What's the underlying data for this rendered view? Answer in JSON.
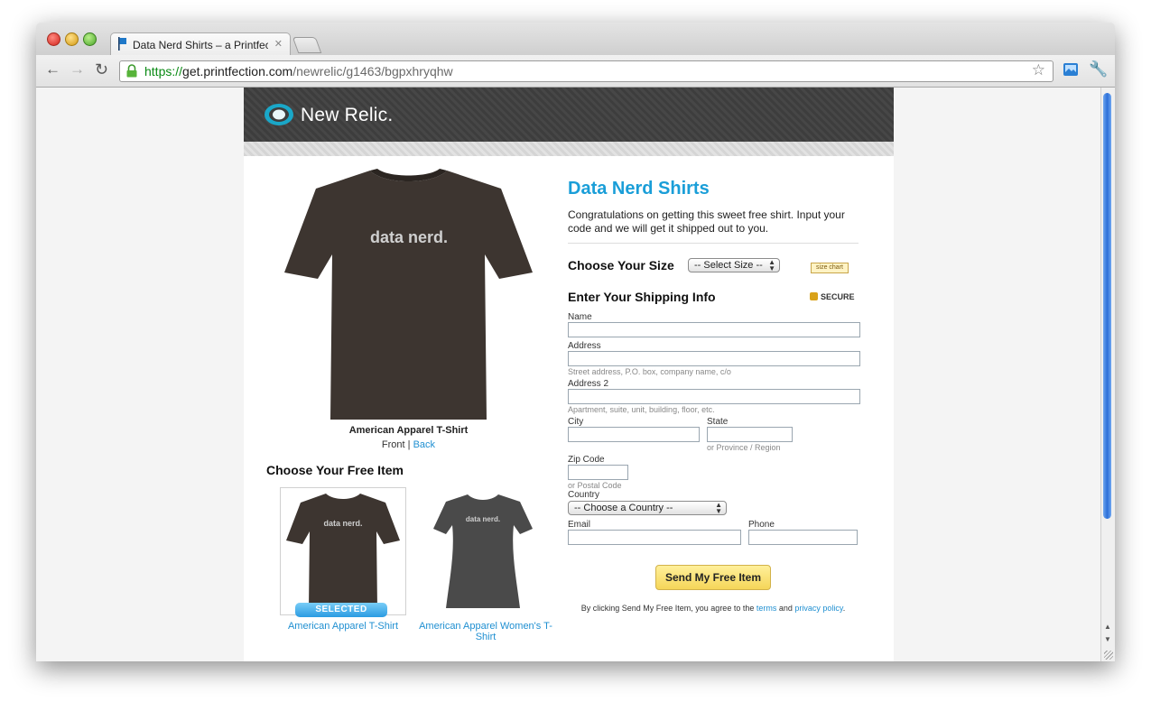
{
  "browser": {
    "tab_title": "Data Nerd Shirts – a Printfecti",
    "tab_close": "✕",
    "url_scheme": "https://",
    "url_host": "get.printfection.com",
    "url_path": "/newrelic/g1463/bgpxhryqhw",
    "back": "←",
    "forward": "→",
    "reload": "↻",
    "star": "☆",
    "wrench": "🔧"
  },
  "banner": {
    "brand": "New Relic."
  },
  "product": {
    "shirt_text": "data nerd.",
    "name": "American Apparel T-Shirt",
    "front_label": "Front",
    "separator": " | ",
    "back_label": "Back"
  },
  "choose_item": {
    "title": "Choose Your Free Item",
    "items": [
      {
        "label": "American Apparel T-Shirt",
        "selected": true,
        "color": "#3d3530"
      },
      {
        "label": "American Apparel Women's T-Shirt",
        "selected": false,
        "color": "#4a4a4a"
      }
    ],
    "selected_badge": "SELECTED"
  },
  "form": {
    "title": "Data Nerd Shirts",
    "intro": "Congratulations on getting this sweet free shirt. Input your code and we will get it shipped out to you.",
    "size_title": "Choose Your Size",
    "size_select": "-- Select Size --",
    "size_chart": "size chart",
    "shipping_title": "Enter Your Shipping Info",
    "secure": "SECURE",
    "name_label": "Name",
    "address_label": "Address",
    "address_hint": "Street address, P.O. box, company name, c/o",
    "address2_label": "Address 2",
    "address2_hint": "Apartment, suite, unit, building, floor, etc.",
    "city_label": "City",
    "state_label": "State",
    "state_hint": "or Province / Region",
    "zip_label": "Zip Code",
    "zip_hint": "or Postal Code",
    "country_label": "Country",
    "country_select": "-- Choose a Country --",
    "email_label": "Email",
    "phone_label": "Phone",
    "submit": "Send My Free Item",
    "agree_prefix": "By clicking Send My Free Item, you agree to the ",
    "terms": "terms",
    "and": " and ",
    "privacy": "privacy policy",
    "period": "."
  },
  "colors": {
    "accent": "#1a9ed8",
    "link": "#1f8fd1",
    "shirt_dark": "#3d3530",
    "shirt_grey": "#4a4a4a"
  }
}
